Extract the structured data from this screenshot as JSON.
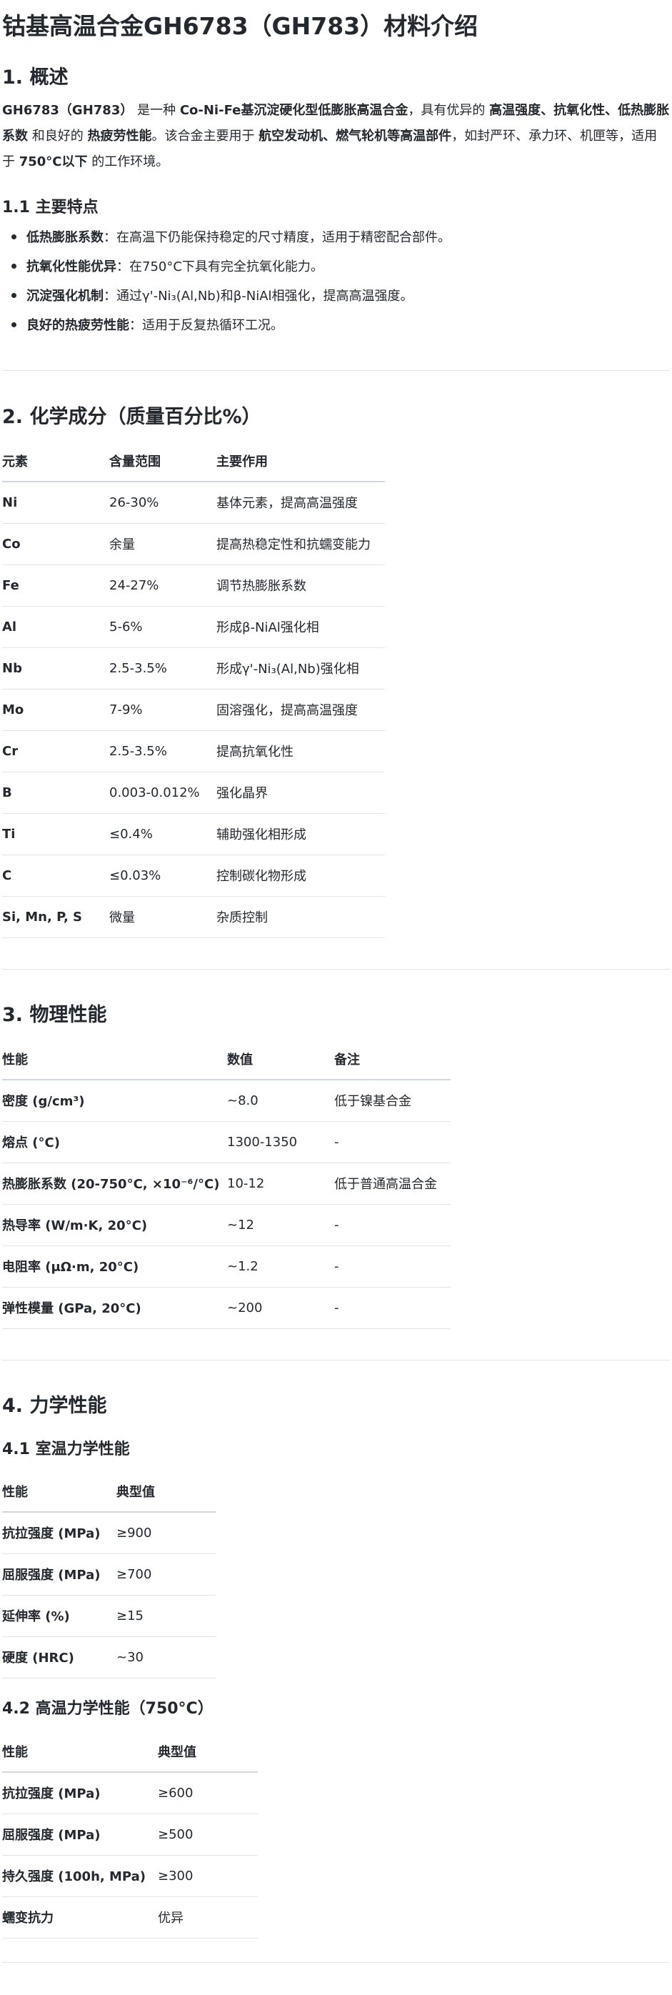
{
  "title": "钴基高温合金GH6783（GH783）材料介绍",
  "s1": {
    "heading": "1. 概述",
    "intro": [
      {
        "t": "GH6783（GH783）",
        "b": true
      },
      {
        "t": " 是一种 ",
        "b": false
      },
      {
        "t": "Co-Ni-Fe基沉淀硬化型低膨胀高温合金",
        "b": true
      },
      {
        "t": "，具有优异的 ",
        "b": false
      },
      {
        "t": "高温强度、抗氧化性、低热膨胀系数",
        "b": true
      },
      {
        "t": " 和良好的 ",
        "b": false
      },
      {
        "t": "热疲劳性能",
        "b": true
      },
      {
        "t": "。该合金主要用于 ",
        "b": false
      },
      {
        "t": "航空发动机、燃气轮机等高温部件",
        "b": true
      },
      {
        "t": "，如封严环、承力环、机匣等，适用于 ",
        "b": false
      },
      {
        "t": "750°C以下",
        "b": true
      },
      {
        "t": " 的工作环境。",
        "b": false
      }
    ],
    "sub_heading": "1.1 主要特点",
    "features": [
      {
        "term": "低热膨胀系数",
        "desc": "：在高温下仍能保持稳定的尺寸精度，适用于精密配合部件。"
      },
      {
        "term": "抗氧化性能优异",
        "desc": "：在750°C下具有完全抗氧化能力。"
      },
      {
        "term": "沉淀强化机制",
        "desc": "：通过γ'-Ni₃(Al,Nb)和β-NiAl相强化，提高高温强度。"
      },
      {
        "term": "良好的热疲劳性能",
        "desc": "：适用于反复热循环工况。"
      }
    ]
  },
  "s2": {
    "heading": "2. 化学成分（质量百分比%）",
    "headers": [
      "元素",
      "含量范围",
      "主要作用"
    ],
    "rows": [
      [
        "Ni",
        "26-30%",
        "基体元素，提高高温强度"
      ],
      [
        "Co",
        "余量",
        "提高热稳定性和抗蠕变能力"
      ],
      [
        "Fe",
        "24-27%",
        "调节热膨胀系数"
      ],
      [
        "Al",
        "5-6%",
        "形成β-NiAl强化相"
      ],
      [
        "Nb",
        "2.5-3.5%",
        "形成γ'-Ni₃(Al,Nb)强化相"
      ],
      [
        "Mo",
        "7-9%",
        "固溶强化，提高高温强度"
      ],
      [
        "Cr",
        "2.5-3.5%",
        "提高抗氧化性"
      ],
      [
        "B",
        "0.003-0.012%",
        "强化晶界"
      ],
      [
        "Ti",
        "≤0.4%",
        "辅助强化相形成"
      ],
      [
        "C",
        "≤0.03%",
        "控制碳化物形成"
      ],
      [
        "Si, Mn, P, S",
        "微量",
        "杂质控制"
      ]
    ]
  },
  "s3": {
    "heading": "3. 物理性能",
    "headers": [
      "性能",
      "数值",
      "备注"
    ],
    "rows": [
      [
        "密度 (g/cm³)",
        "~8.0",
        "低于镍基合金"
      ],
      [
        "熔点 (°C)",
        "1300-1350",
        "-"
      ],
      [
        "热膨胀系数 (20-750°C, ×10⁻⁶/°C)",
        "10-12",
        "低于普通高温合金"
      ],
      [
        "热导率 (W/m·K, 20°C)",
        "~12",
        "-"
      ],
      [
        "电阻率 (μΩ·m, 20°C)",
        "~1.2",
        "-"
      ],
      [
        "弹性模量 (GPa, 20°C)",
        "~200",
        "-"
      ]
    ]
  },
  "s4": {
    "heading": "4. 力学性能",
    "sub1": {
      "heading": "4.1 室温力学性能",
      "headers": [
        "性能",
        "典型值"
      ],
      "rows": [
        [
          "抗拉强度 (MPa)",
          "≥900"
        ],
        [
          "屈服强度 (MPa)",
          "≥700"
        ],
        [
          "延伸率 (%)",
          "≥15"
        ],
        [
          "硬度 (HRC)",
          "~30"
        ]
      ]
    },
    "sub2": {
      "heading": "4.2 高温力学性能（750°C）",
      "headers": [
        "性能",
        "典型值"
      ],
      "rows": [
        [
          "抗拉强度 (MPa)",
          "≥600"
        ],
        [
          "屈服强度 (MPa)",
          "≥500"
        ],
        [
          "持久强度 (100h, MPa)",
          "≥300"
        ],
        [
          "蠕变抗力",
          "优异"
        ]
      ]
    }
  }
}
